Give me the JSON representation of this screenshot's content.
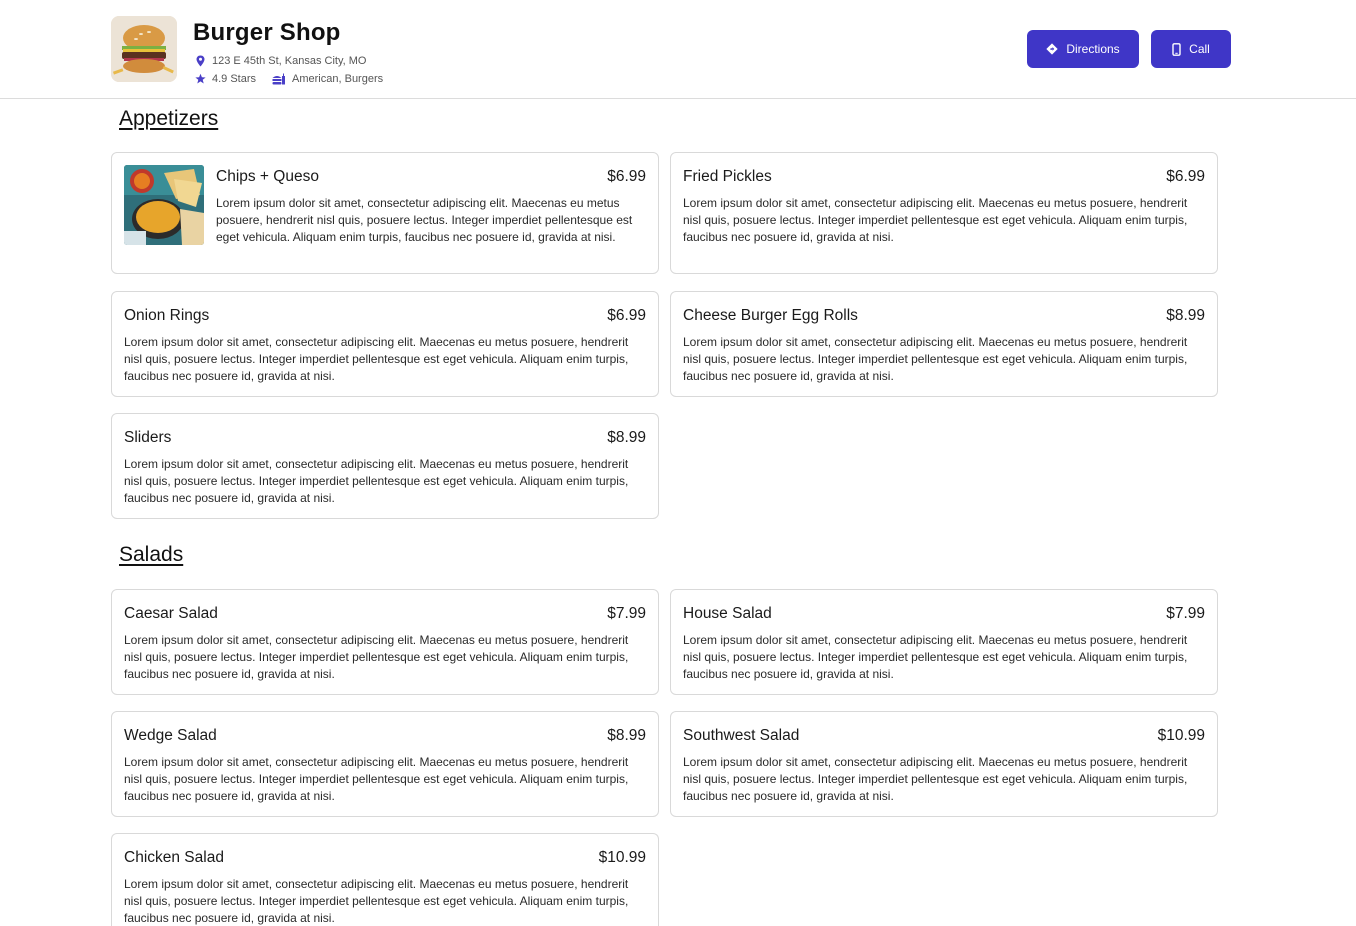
{
  "shop": {
    "name": "Burger Shop",
    "address": "123 E 45th St, Kansas City, MO",
    "rating": "4.9 Stars",
    "cuisine": "American, Burgers"
  },
  "actions": {
    "directions_label": "Directions",
    "call_label": "Call"
  },
  "colors": {
    "accent": "#3f36c7"
  },
  "icons": {
    "address": "map-pin-icon",
    "rating": "star-icon",
    "cuisine": "fast-food-icon",
    "directions": "diamond-arrow-icon",
    "call": "phone-icon"
  },
  "sections": [
    {
      "title": "Appetizers",
      "items": [
        {
          "name": "Chips + Queso",
          "price": "$6.99",
          "description": "Lorem ipsum dolor sit amet, consectetur adipiscing elit. Maecenas eu metus posuere, hendrerit nisl quis, posuere lectus. Integer imperdiet pellentesque est eget vehicula. Aliquam enim turpis, faucibus nec posuere id, gravida at nisi."
        },
        {
          "name": "Fried Pickles",
          "price": "$6.99",
          "description": "Lorem ipsum dolor sit amet, consectetur adipiscing elit. Maecenas eu metus posuere, hendrerit nisl quis, posuere lectus. Integer imperdiet pellentesque est eget vehicula. Aliquam enim turpis, faucibus nec posuere id, gravida at nisi."
        },
        {
          "name": "Onion Rings",
          "price": "$6.99",
          "description": "Lorem ipsum dolor sit amet, consectetur adipiscing elit. Maecenas eu metus posuere, hendrerit nisl quis, posuere lectus. Integer imperdiet pellentesque est eget vehicula. Aliquam enim turpis, faucibus nec posuere id, gravida at nisi."
        },
        {
          "name": "Cheese Burger Egg Rolls",
          "price": "$8.99",
          "description": "Lorem ipsum dolor sit amet, consectetur adipiscing elit. Maecenas eu metus posuere, hendrerit nisl quis, posuere lectus. Integer imperdiet pellentesque est eget vehicula. Aliquam enim turpis, faucibus nec posuere id, gravida at nisi."
        },
        {
          "name": "Sliders",
          "price": "$8.99",
          "description": "Lorem ipsum dolor sit amet, consectetur adipiscing elit. Maecenas eu metus posuere, hendrerit nisl quis, posuere lectus. Integer imperdiet pellentesque est eget vehicula. Aliquam enim turpis, faucibus nec posuere id, gravida at nisi."
        }
      ]
    },
    {
      "title": "Salads",
      "items": [
        {
          "name": "Caesar Salad",
          "price": "$7.99",
          "description": "Lorem ipsum dolor sit amet, consectetur adipiscing elit. Maecenas eu metus posuere, hendrerit nisl quis, posuere lectus. Integer imperdiet pellentesque est eget vehicula. Aliquam enim turpis, faucibus nec posuere id, gravida at nisi."
        },
        {
          "name": "House Salad",
          "price": "$7.99",
          "description": "Lorem ipsum dolor sit amet, consectetur adipiscing elit. Maecenas eu metus posuere, hendrerit nisl quis, posuere lectus. Integer imperdiet pellentesque est eget vehicula. Aliquam enim turpis, faucibus nec posuere id, gravida at nisi."
        },
        {
          "name": "Wedge Salad",
          "price": "$8.99",
          "description": "Lorem ipsum dolor sit amet, consectetur adipiscing elit. Maecenas eu metus posuere, hendrerit nisl quis, posuere lectus. Integer imperdiet pellentesque est eget vehicula. Aliquam enim turpis, faucibus nec posuere id, gravida at nisi."
        },
        {
          "name": "Southwest Salad",
          "price": "$10.99",
          "description": "Lorem ipsum dolor sit amet, consectetur adipiscing elit. Maecenas eu metus posuere, hendrerit nisl quis, posuere lectus. Integer imperdiet pellentesque est eget vehicula. Aliquam enim turpis, faucibus nec posuere id, gravida at nisi."
        },
        {
          "name": "Chicken Salad",
          "price": "$10.99",
          "description": "Lorem ipsum dolor sit amet, consectetur adipiscing elit. Maecenas eu metus posuere, hendrerit nisl quis, posuere lectus. Integer imperdiet pellentesque est eget vehicula. Aliquam enim turpis, faucibus nec posuere id, gravida at nisi."
        }
      ]
    }
  ]
}
